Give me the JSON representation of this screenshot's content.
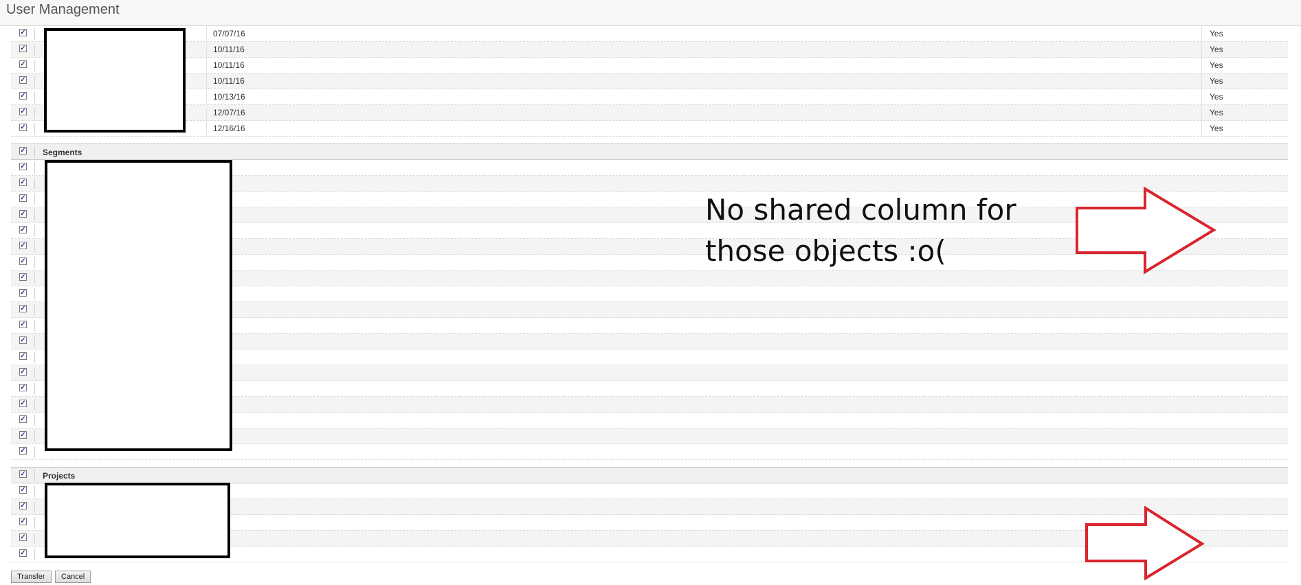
{
  "window": {
    "title": "User Management"
  },
  "reports": {
    "rows": [
      {
        "date": "07/07/16",
        "shared": "Yes"
      },
      {
        "date": "10/11/16",
        "shared": "Yes"
      },
      {
        "date": "10/11/16",
        "shared": "Yes"
      },
      {
        "date": "10/11/16",
        "shared": "Yes"
      },
      {
        "date": "10/13/16",
        "shared": "Yes"
      },
      {
        "date": "12/07/16",
        "shared": "Yes"
      },
      {
        "date": "12/16/16",
        "shared": "Yes"
      }
    ]
  },
  "segments": {
    "header": "Segments",
    "row_count": 19
  },
  "projects": {
    "header": "Projects",
    "row_count": 5
  },
  "checkbox_glyph": "✓",
  "annotation": {
    "line1": "No shared column for",
    "line2": "those objects :o("
  },
  "annotation_color": "#d9262e",
  "buttons": {
    "transfer": "Transfer",
    "cancel": "Cancel"
  }
}
